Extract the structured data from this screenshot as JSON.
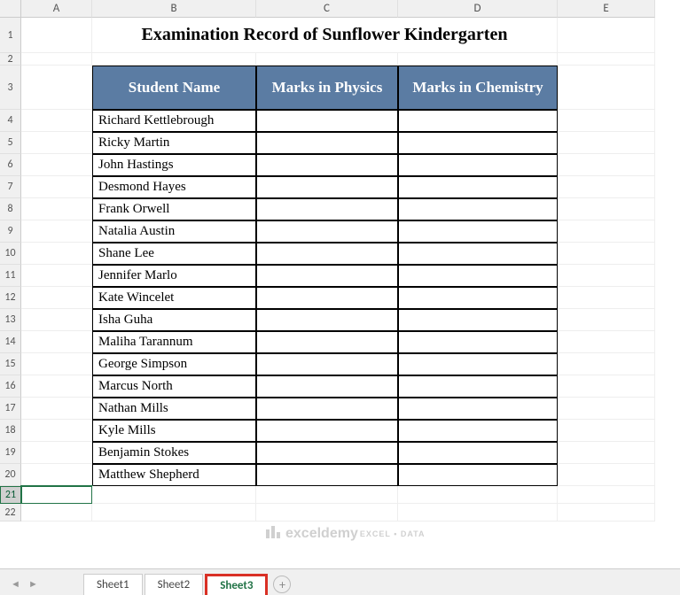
{
  "columns": [
    "A",
    "B",
    "C",
    "D",
    "E"
  ],
  "rows": [
    1,
    2,
    3,
    4,
    5,
    6,
    7,
    8,
    9,
    10,
    11,
    12,
    13,
    14,
    15,
    16,
    17,
    18,
    19,
    20,
    21,
    22
  ],
  "title": "Examination Record of Sunflower Kindergarten",
  "headers": {
    "name": "Student Name",
    "physics": "Marks in Physics",
    "chemistry": "Marks in Chemistry"
  },
  "students": [
    "Richard Kettlebrough",
    "Ricky Martin",
    "John Hastings",
    "Desmond Hayes",
    "Frank Orwell",
    "Natalia Austin",
    "Shane Lee",
    "Jennifer Marlo",
    "Kate Wincelet",
    "Isha Guha",
    "Maliha Tarannum",
    "George Simpson",
    "Marcus North",
    "Nathan Mills",
    "Kyle Mills",
    "Benjamin Stokes",
    "Matthew Shepherd"
  ],
  "selected_row": 21,
  "sheets": {
    "items": [
      "Sheet1",
      "Sheet2",
      "Sheet3"
    ],
    "active": "Sheet3"
  },
  "watermark": {
    "brand": "exceldemy",
    "sub": "EXCEL • DATA"
  },
  "newtab": "+"
}
